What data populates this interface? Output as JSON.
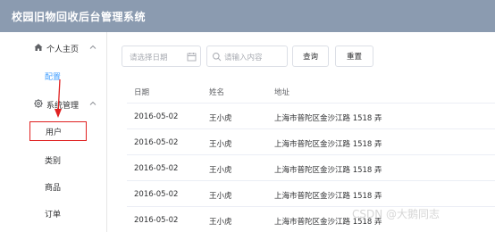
{
  "header": {
    "title": "校园旧物回收后台管理系统",
    "bg_color": "#8b9bb0"
  },
  "sidebar": {
    "groups": [
      {
        "label": "个人主页",
        "icon": "home-icon",
        "expanded": true,
        "items": [
          {
            "label": "配置",
            "active": true
          }
        ]
      },
      {
        "label": "系统管理",
        "icon": "gear-icon",
        "expanded": true,
        "items": [
          {
            "label": "用户",
            "highlighted": true
          },
          {
            "label": "类别"
          },
          {
            "label": "商品"
          },
          {
            "label": "订单"
          }
        ]
      }
    ]
  },
  "toolbar": {
    "date_placeholder": "请选择日期",
    "search_placeholder": "请输入内容",
    "query_label": "查询",
    "reset_label": "重置"
  },
  "table": {
    "columns": [
      "日期",
      "姓名",
      "地址"
    ],
    "rows": [
      [
        "2016-05-02",
        "王小虎",
        "上海市普陀区金沙江路 1518 弄"
      ],
      [
        "2016-05-02",
        "王小虎",
        "上海市普陀区金沙江路 1518 弄"
      ],
      [
        "2016-05-02",
        "王小虎",
        "上海市普陀区金沙江路 1518 弄"
      ],
      [
        "2016-05-02",
        "王小虎",
        "上海市普陀区金沙江路 1518 弄"
      ],
      [
        "2016-05-02",
        "王小虎",
        "上海市普陀区金沙江路 1518 弄"
      ]
    ]
  },
  "watermark": "CSDN @大鹅同志",
  "colors": {
    "accent": "#409eff",
    "annotation": "#e02020"
  }
}
